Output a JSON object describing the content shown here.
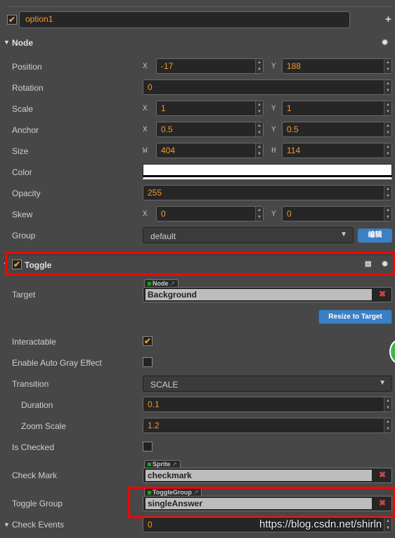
{
  "node_name": "option1",
  "node_section": {
    "title": "Node",
    "position": {
      "label": "Position",
      "x": "-17",
      "y": "188"
    },
    "rotation": {
      "label": "Rotation",
      "value": "0"
    },
    "scale": {
      "label": "Scale",
      "x": "1",
      "y": "1"
    },
    "anchor": {
      "label": "Anchor",
      "x": "0.5",
      "y": "0.5"
    },
    "size": {
      "label": "Size",
      "w": "404",
      "h": "114"
    },
    "color": {
      "label": "Color",
      "value": "#ffffff"
    },
    "opacity": {
      "label": "Opacity",
      "value": "255"
    },
    "skew": {
      "label": "Skew",
      "x": "0",
      "y": "0"
    },
    "group": {
      "label": "Group",
      "value": "default",
      "edit_button": "编辑"
    }
  },
  "axes": {
    "x": "X",
    "y": "Y",
    "w": "W",
    "h": "H"
  },
  "toggle_section": {
    "title": "Toggle",
    "target": {
      "label": "Target",
      "type": "Node",
      "value": "Background"
    },
    "resize_button": "Resize to Target",
    "interactable": {
      "label": "Interactable",
      "checked": true
    },
    "auto_gray": {
      "label": "Enable Auto Gray Effect",
      "checked": false
    },
    "transition": {
      "label": "Transition",
      "value": "SCALE"
    },
    "duration": {
      "label": "Duration",
      "value": "0.1"
    },
    "zoom_scale": {
      "label": "Zoom Scale",
      "value": "1.2"
    },
    "is_checked": {
      "label": "Is Checked",
      "checked": false
    },
    "check_mark": {
      "label": "Check Mark",
      "type": "Sprite",
      "value": "checkmark"
    },
    "toggle_group": {
      "label": "Toggle Group",
      "type": "ToggleGroup",
      "value": "singleAnswer"
    },
    "check_events": {
      "label": "Check Events",
      "value": "0"
    }
  },
  "watermark": "https://blog.csdn.net/shirln"
}
